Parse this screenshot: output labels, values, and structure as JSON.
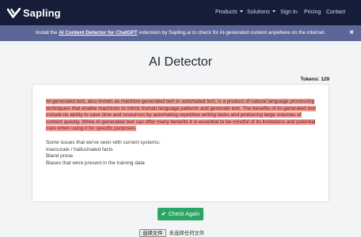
{
  "header": {
    "brand": "Sapling",
    "nav": [
      {
        "label": "Products",
        "dropdown": true
      },
      {
        "label": "Solutions",
        "dropdown": true
      },
      {
        "label": "Sign In",
        "dropdown": false
      },
      {
        "label": "Pricing",
        "dropdown": false
      },
      {
        "label": "Contact",
        "dropdown": false
      }
    ]
  },
  "banner": {
    "before": "Install the ",
    "link": "AI Content Detector for ChatGPT",
    "after": " extension by Sapling.ai to check for AI-generated content anywhere on the internet.",
    "close": "×"
  },
  "main": {
    "title": "AI Detector",
    "tokens": "Tokens: 129",
    "highlighted_text": "AI-generated text, also known as machine-generated text or automated text, is a product of natural language processing techniques that enable machines to mimic human language patterns and generate text. The benefits of AI-generated text include its ability to save time and resources by automating repetitive writing tasks and producing large volumes of content quickly. While AI-generated text can offer many benefits it is essential to be mindful of its limitations and potential risks when using it for specific purposes.",
    "issues_intro": "Some issues that we've seen with current systems:",
    "issues": [
      "Inaccurate / hallucinated facts",
      "Bland prose",
      "Biases that were present in the training data"
    ],
    "check_button": "Check Again",
    "file_button": "选择文件",
    "file_status": "未选择任何文件"
  },
  "colors": {
    "navbar": "#151d38",
    "banner": "#5d6797",
    "highlight": "#f09a94",
    "button": "#2aa564"
  },
  "icons": {
    "logo": "sapling-logo-icon",
    "check": "check-icon",
    "close": "close-icon",
    "caret": "chevron-down-icon"
  }
}
